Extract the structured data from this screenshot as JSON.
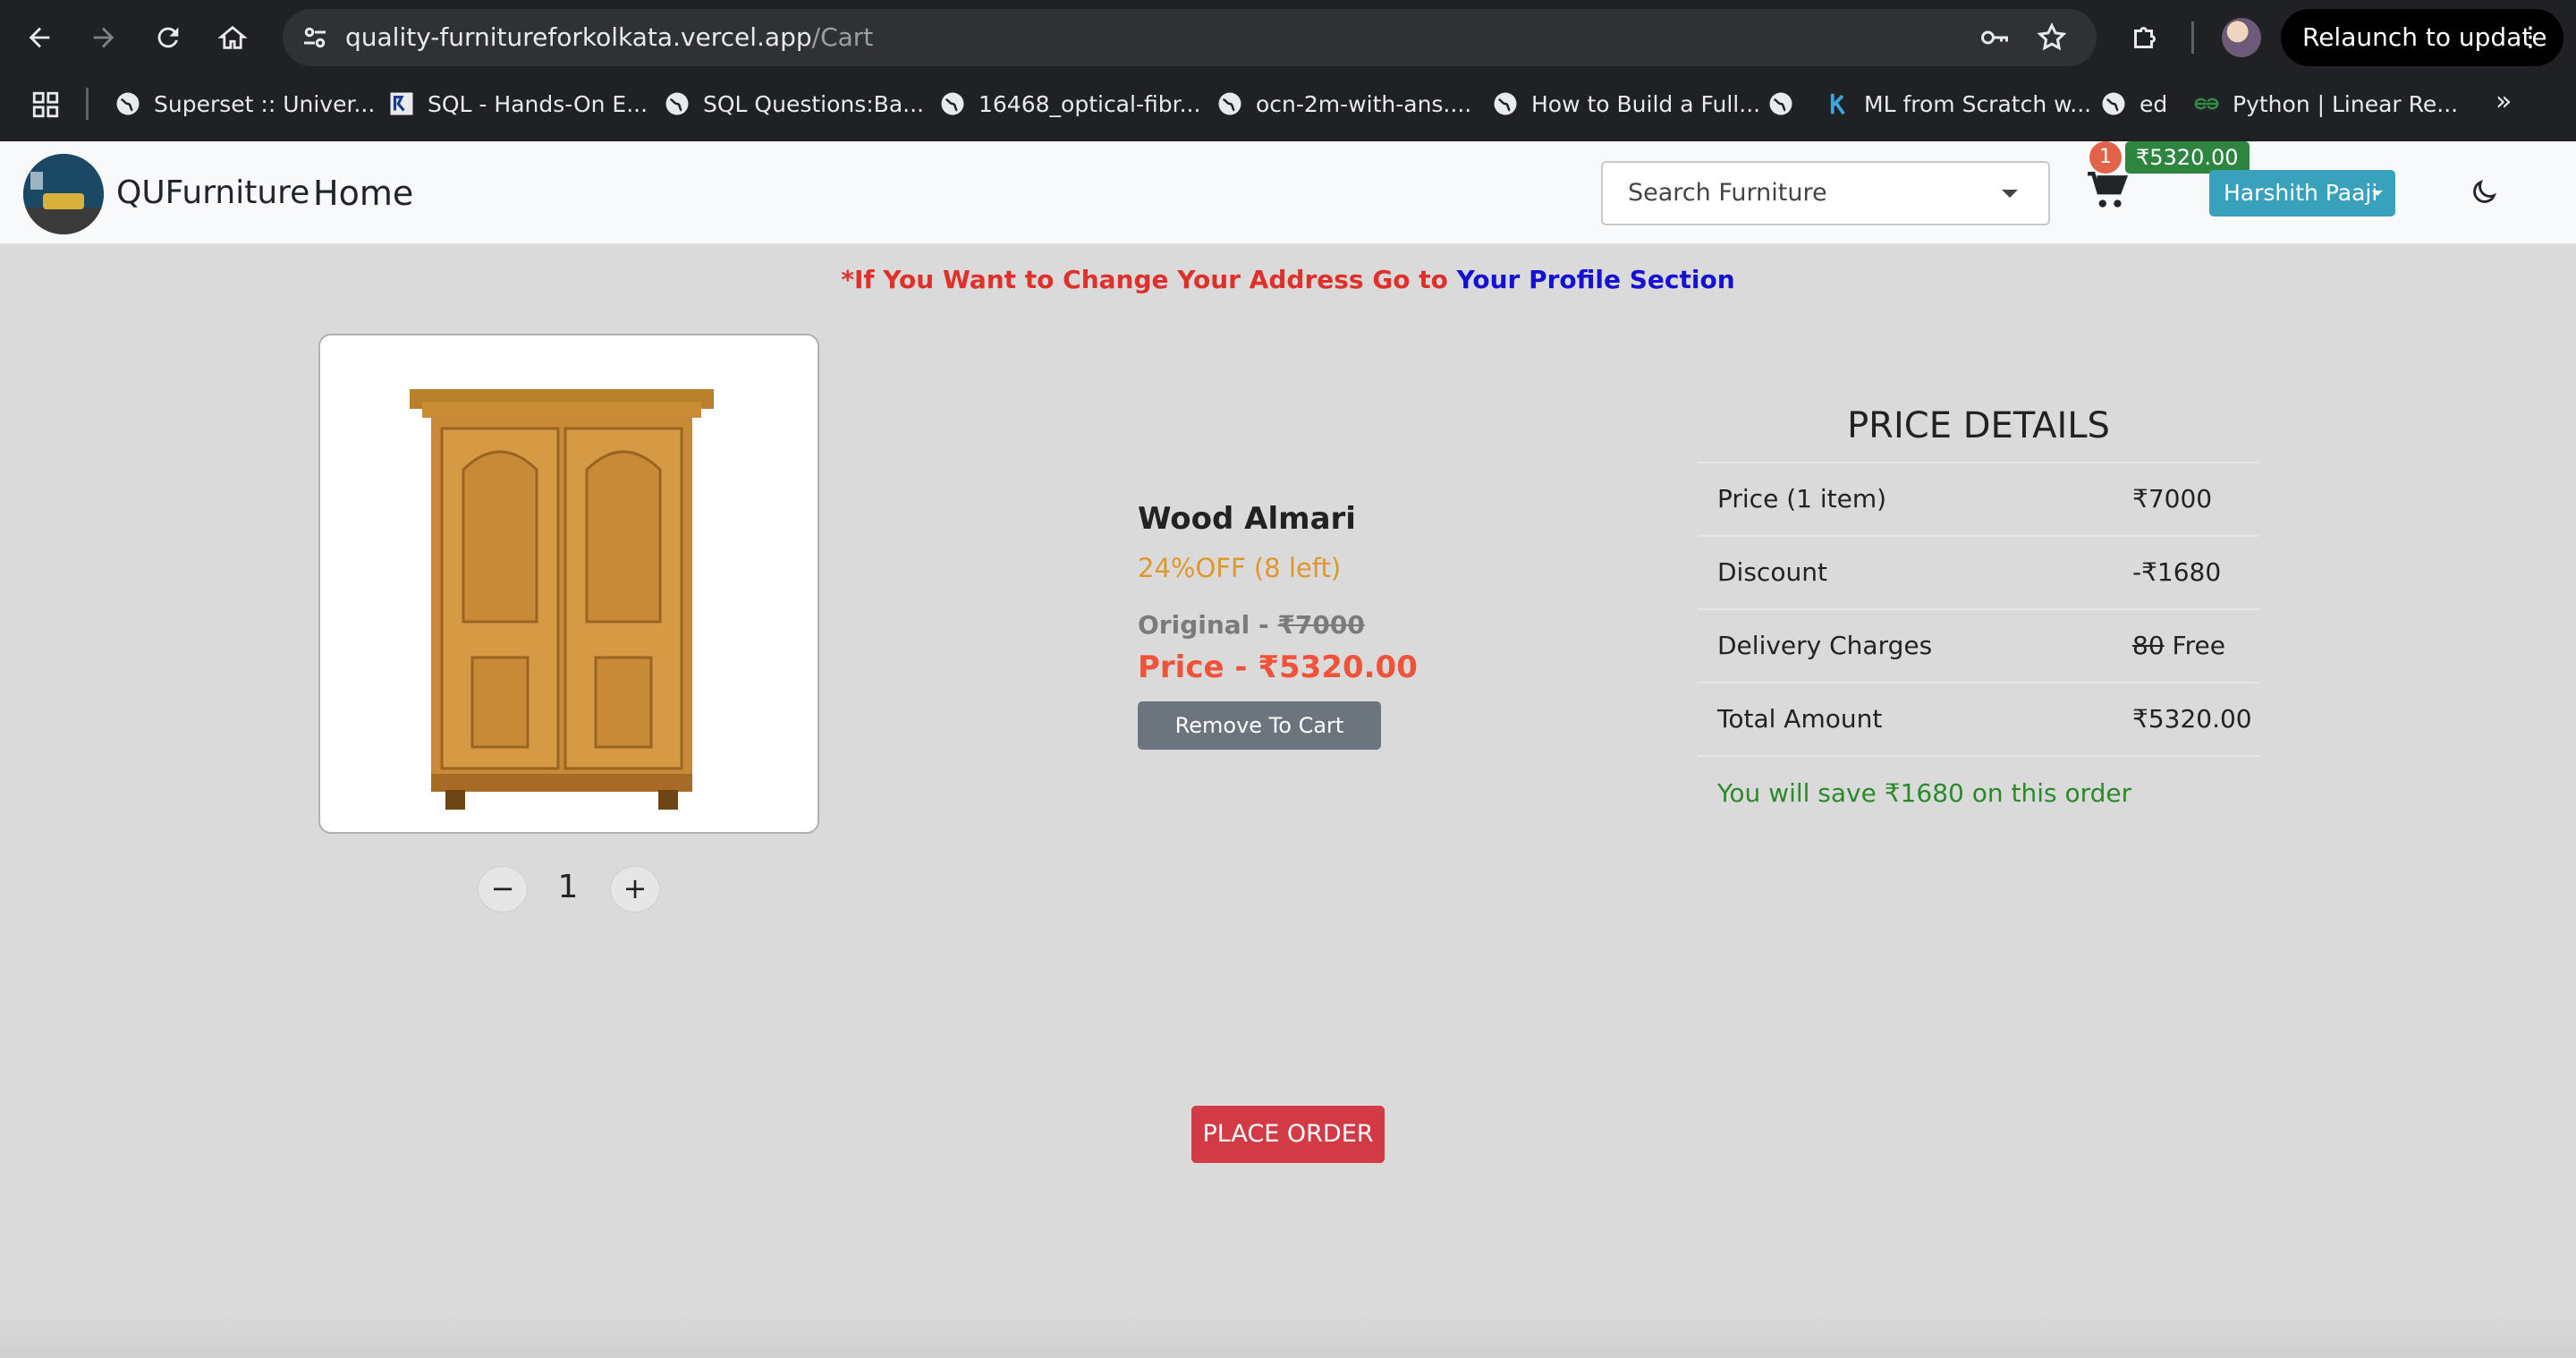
{
  "browser": {
    "url_host": "quality-furnitureforkolkata.vercel.app",
    "url_path": "/Cart",
    "relaunch_label": "Relaunch to update",
    "bookmarks": [
      {
        "label": "Superset :: Univer...",
        "icon": "globe-icon"
      },
      {
        "label": "SQL - Hands-On E...",
        "icon": "course-icon"
      },
      {
        "label": "SQL Questions:Ba...",
        "icon": "globe-icon"
      },
      {
        "label": "16468_optical-fibr...",
        "icon": "globe-icon"
      },
      {
        "label": "ocn-2m-with-ans....",
        "icon": "globe-icon"
      },
      {
        "label": "How to Build a Full...",
        "icon": "globe-icon"
      },
      {
        "label": "",
        "icon": "globe-icon"
      },
      {
        "label": "ML from Scratch w...",
        "icon": "k-icon"
      },
      {
        "label": "ed",
        "icon": "globe-icon"
      },
      {
        "label": "Python | Linear Re...",
        "icon": "gfg-icon"
      }
    ]
  },
  "navbar": {
    "brand": "QUFurniture",
    "home": "Home",
    "search_placeholder": "Search Furniture",
    "cart_count": "1",
    "cart_total": "₹5320.00",
    "user_name": "Harshith Paaji"
  },
  "notice": {
    "text": "*If You Want to Change Your Address Go to ",
    "link": "Your Profile Section"
  },
  "product": {
    "name": "Wood Almari",
    "discount": "24%OFF (8 left)",
    "original_label": "Original - ",
    "original_price": "₹7000",
    "price": "Price - ₹5320.00",
    "remove_label": "Remove To Cart",
    "quantity": "1",
    "minus": "−",
    "plus": "+"
  },
  "price_details": {
    "title": "PRICE DETAILS",
    "rows": [
      {
        "label": "Price (1 item)",
        "value": "₹7000"
      },
      {
        "label": "Discount",
        "value": "-₹1680"
      },
      {
        "label": "Delivery Charges",
        "value_struck": "80",
        "value": " Free"
      },
      {
        "label": "Total Amount",
        "value": "₹5320.00"
      }
    ],
    "savings": "You will save ₹1680 on this order"
  },
  "place_order_label": "PLACE ORDER",
  "colors": {
    "accent_blue": "#3aa1bd",
    "cart_badge": "#e0634a",
    "cart_total_bg": "#2e8540",
    "place_order": "#d23b45",
    "notice_red": "#e0302a",
    "notice_link": "#1510d4"
  }
}
